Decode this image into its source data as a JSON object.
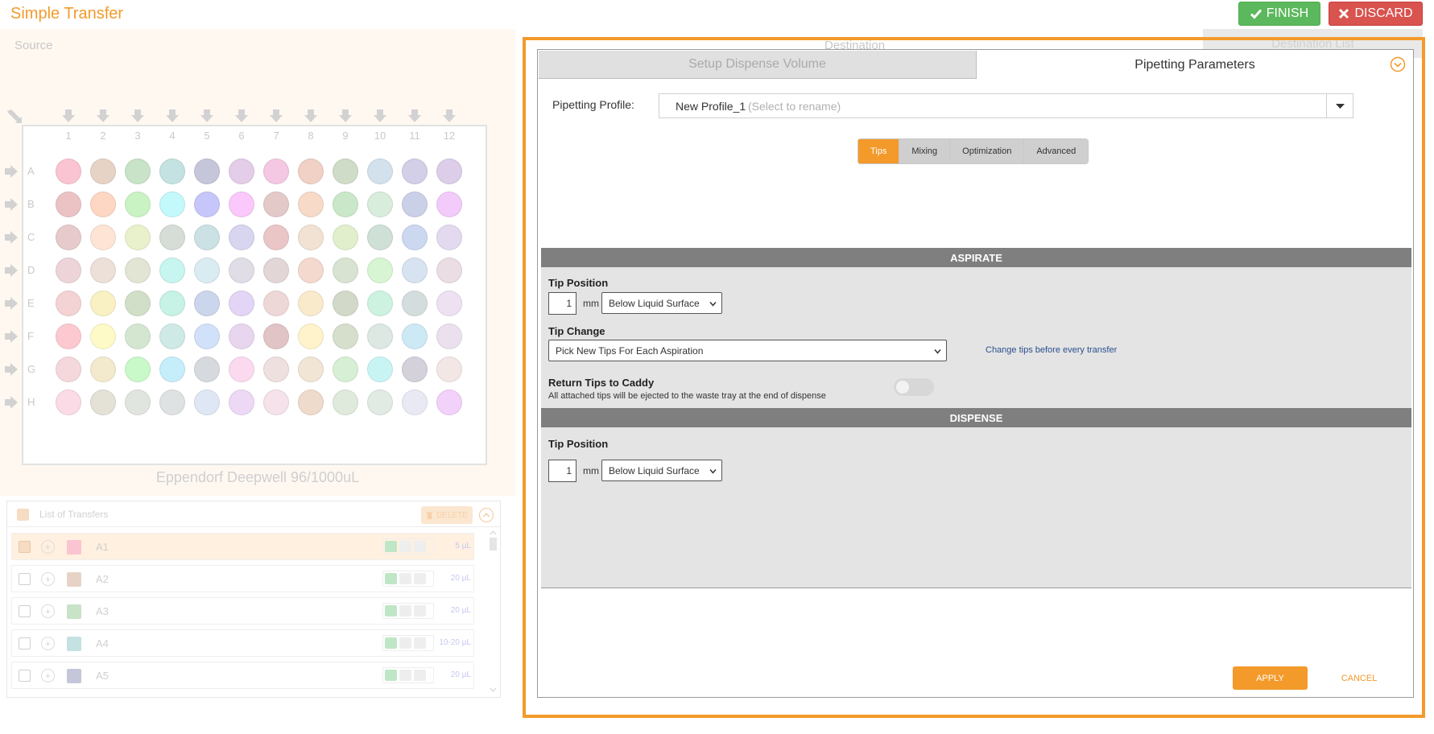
{
  "header": {
    "title": "Simple Transfer",
    "finish_label": "FINISH",
    "discard_label": "DISCARD",
    "finish_color": "#5cb85c",
    "discard_color": "#d9534f",
    "accent_color": "#f39a2b"
  },
  "background": {
    "source_label": "Source",
    "destination_label": "Destination",
    "destination_list_label": "Destination List",
    "plate_name": "Eppendorf Deepwell 96/1000uL",
    "columns": [
      "1",
      "2",
      "3",
      "4",
      "5",
      "6",
      "7",
      "8",
      "9",
      "10",
      "11",
      "12"
    ],
    "rows": [
      "A",
      "B",
      "C",
      "D",
      "E",
      "F",
      "G",
      "H"
    ],
    "well_colors": [
      [
        "#fbc4d2",
        "#e7d3c6",
        "#c8e3c7",
        "#c4e2e1",
        "#c6c6db",
        "#e3cde8",
        "#f4c8e2",
        "#f1d1c6",
        "#cfdcc8",
        "#d2e1ec",
        "#d3cfe8",
        "#dccde9"
      ],
      [
        "#ecc3c5",
        "#fdd7c3",
        "#c9f3c3",
        "#c4f9fb",
        "#c6c6fa",
        "#fbc8fb",
        "#e4c9c9",
        "#f7dac8",
        "#cae8c9",
        "#d8eddb",
        "#cad0e8",
        "#f3cbfa"
      ],
      [
        "#e7cbcc",
        "#fde4d5",
        "#e8f1cb",
        "#d5ddd6",
        "#cce1e3",
        "#d7d5ef",
        "#eac6c7",
        "#f1e2d4",
        "#e1efcd",
        "#cfe0d7",
        "#ccd7f0",
        "#e3daf0"
      ],
      [
        "#edd4d8",
        "#ece0d9",
        "#e2e5d3",
        "#c7f5ef",
        "#d9ecf2",
        "#e0dde6",
        "#e2d6d6",
        "#f4d9ce",
        "#d8e4d1",
        "#d7f5d2",
        "#d7e3f0",
        "#ebdde4"
      ],
      [
        "#f3d3d4",
        "#f9f1c3",
        "#d2dfc8",
        "#c7f2e6",
        "#cbd5eb",
        "#e3d5f5",
        "#eed8d7",
        "#faeacc",
        "#d3d9c9",
        "#cdf3e0",
        "#d4dddd",
        "#ede1f2"
      ],
      [
        "#fcc9d1",
        "#fdfac8",
        "#d4e6d0",
        "#cfe9e6",
        "#d2e1fa",
        "#e8d6ef",
        "#e0c4c6",
        "#fef3cb",
        "#d6dfcc",
        "#dde8e3",
        "#cde9f5",
        "#ebe1ee"
      ],
      [
        "#f4d8dc",
        "#f3eace",
        "#c9f9c8",
        "#c6edfa",
        "#d6dadf",
        "#fbdaf0",
        "#eee0de",
        "#f1e5d5",
        "#d6efd5",
        "#c9f4f4",
        "#d4d1db",
        "#f3e7e6"
      ],
      [
        "#fbdbe5",
        "#e4e1d7",
        "#e1e5df",
        "#dfe2e3",
        "#dfe7f4",
        "#edd9f5",
        "#f6e2ea",
        "#efdbcc",
        "#dfeadd",
        "#e1ebe3",
        "#e9e9f3",
        "#f2d1fa"
      ]
    ],
    "transfers": {
      "title": "List of Transfers",
      "delete_label": "DELETE",
      "rows": [
        {
          "well": "A1",
          "volume": "5 µL",
          "swatch": "#fbc4d2",
          "selected": true
        },
        {
          "well": "A2",
          "volume": "20 µL",
          "swatch": "#e7d3c6",
          "selected": false
        },
        {
          "well": "A3",
          "volume": "20 µL",
          "swatch": "#c8e3c7",
          "selected": false
        },
        {
          "well": "A4",
          "volume": "10-20 µL",
          "swatch": "#c4e2e1",
          "selected": false
        },
        {
          "well": "A5",
          "volume": "20 µL",
          "swatch": "#c6c6db",
          "selected": false
        }
      ]
    }
  },
  "dialog": {
    "tab_setup_label": "Setup Dispense Volume",
    "tab_params_label": "Pipetting Parameters",
    "profile_label": "Pipetting Profile:",
    "profile_name": "New Profile_1",
    "profile_hint": "(Select to rename)",
    "subtabs": [
      "Tips",
      "Mixing",
      "Optimization",
      "Advanced"
    ],
    "active_subtab": "Tips",
    "aspirate": {
      "title": "ASPIRATE",
      "tip_position_label": "Tip Position",
      "tip_position_value": "1",
      "unit": "mm",
      "reference": "Below Liquid Surface",
      "tip_change_label": "Tip Change",
      "tip_change_value": "Pick New Tips For Each Aspiration",
      "tip_change_hint": "Change tips before every transfer",
      "return_tips_label": "Return Tips to Caddy",
      "return_tips_desc": "All attached tips will be ejected to the waste tray at the end of dispense",
      "return_tips_on": false
    },
    "dispense": {
      "title": "DISPENSE",
      "tip_position_label": "Tip Position",
      "tip_position_value": "1",
      "unit": "mm",
      "reference": "Below Liquid Surface"
    },
    "apply_label": "APPLY",
    "cancel_label": "CANCEL"
  }
}
